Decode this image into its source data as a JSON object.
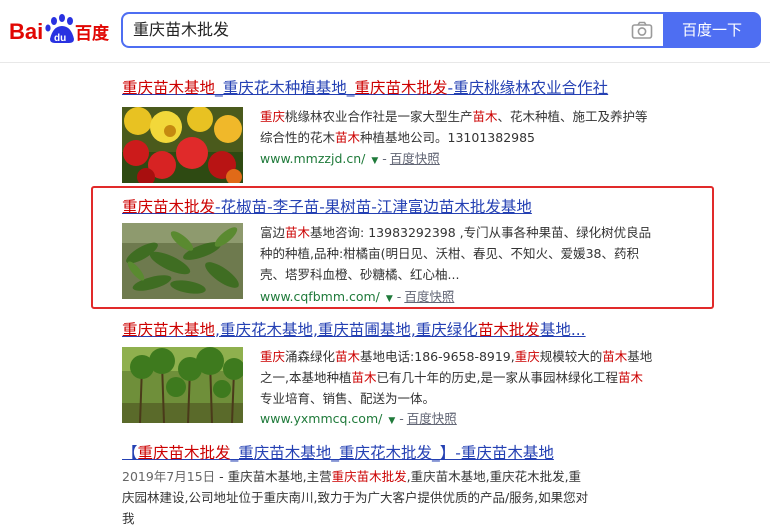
{
  "header": {
    "logo_text": "Bai百度",
    "search_value": "重庆苗木批发",
    "search_button": "百度一下",
    "logo_colors": {
      "red": "#e10602",
      "blue": "#2932e1"
    }
  },
  "results": [
    {
      "title_parts": [
        {
          "t": "重庆苗木基地",
          "em": true
        },
        {
          "t": "_重庆花木种植基地_",
          "em": false
        },
        {
          "t": "重庆苗木批发",
          "em": true
        },
        {
          "t": "-重庆桃缘林农业合作社",
          "em": false
        }
      ],
      "desc_parts": [
        {
          "t": "重庆",
          "em": true
        },
        {
          "t": "桃缘林农业合作社是一家大型生产",
          "em": false
        },
        {
          "t": "苗木",
          "em": true
        },
        {
          "t": "、花木种植、施工及养护等综合性的花木",
          "em": false
        },
        {
          "t": "苗木",
          "em": true
        },
        {
          "t": "种植基地公司。13101382985",
          "em": false
        }
      ],
      "url": "www.mmzzjd.cn/",
      "kuaizhao": "百度快照",
      "thumb": "red-yellow-flowers"
    },
    {
      "title_parts": [
        {
          "t": "重庆苗木批发",
          "em": true
        },
        {
          "t": "-花椒苗-李子苗-果树苗-江津富边苗木批发基地",
          "em": false
        }
      ],
      "desc_parts": [
        {
          "t": "富边",
          "em": false
        },
        {
          "t": "苗木",
          "em": true
        },
        {
          "t": "基地咨询: 13983292398 ,专门从事各种果苗、绿化树优良品种的种植,品种:柑橘亩(明日见、沃柑、春见、不知火、爱媛38、药积壳、塔罗科血橙、砂糖橘、红心柚...",
          "em": false
        }
      ],
      "url": "www.cqfbmm.com/",
      "kuaizhao": "百度快照",
      "thumb": "green-leaves"
    },
    {
      "title_parts": [
        {
          "t": "重庆苗木基地",
          "em": true
        },
        {
          "t": ",重庆花木基地,重庆苗圃基地,重庆绿化",
          "em": false
        },
        {
          "t": "苗木批发",
          "em": true
        },
        {
          "t": "基地...",
          "em": false
        }
      ],
      "desc_parts": [
        {
          "t": "重庆",
          "em": true
        },
        {
          "t": "涌森绿化",
          "em": false
        },
        {
          "t": "苗木",
          "em": true
        },
        {
          "t": "基地电话:186-9658-8919,",
          "em": false
        },
        {
          "t": "重庆",
          "em": true
        },
        {
          "t": "规模较大的",
          "em": false
        },
        {
          "t": "苗木",
          "em": true
        },
        {
          "t": "基地之一,本基地种植",
          "em": false
        },
        {
          "t": "苗木",
          "em": true
        },
        {
          "t": "已有几十年的历史,是一家从事园林绿化工程",
          "em": false
        },
        {
          "t": "苗木",
          "em": true
        },
        {
          "t": "专业培育、销售、配送为一体。",
          "em": false
        }
      ],
      "url": "www.yxmmcq.com/",
      "kuaizhao": "百度快照",
      "thumb": "saplings"
    },
    {
      "title_parts": [
        {
          "t": "【",
          "em": false
        },
        {
          "t": "重庆苗木批发",
          "em": true
        },
        {
          "t": "_重庆苗木基地_重庆花木批发_】-重庆苗木基地",
          "em": false
        }
      ],
      "date": "2019年7月15日",
      "desc_parts": [
        {
          "t": " - 重庆苗木基地,主营",
          "em": false
        },
        {
          "t": "重庆苗木批发",
          "em": true
        },
        {
          "t": ",重庆苗木基地,重庆花木批发,重庆园林建设,公司地址位于重庆南川,致力于为广大客户提供优质的产品/服务,如果您对我",
          "em": false
        }
      ]
    }
  ]
}
